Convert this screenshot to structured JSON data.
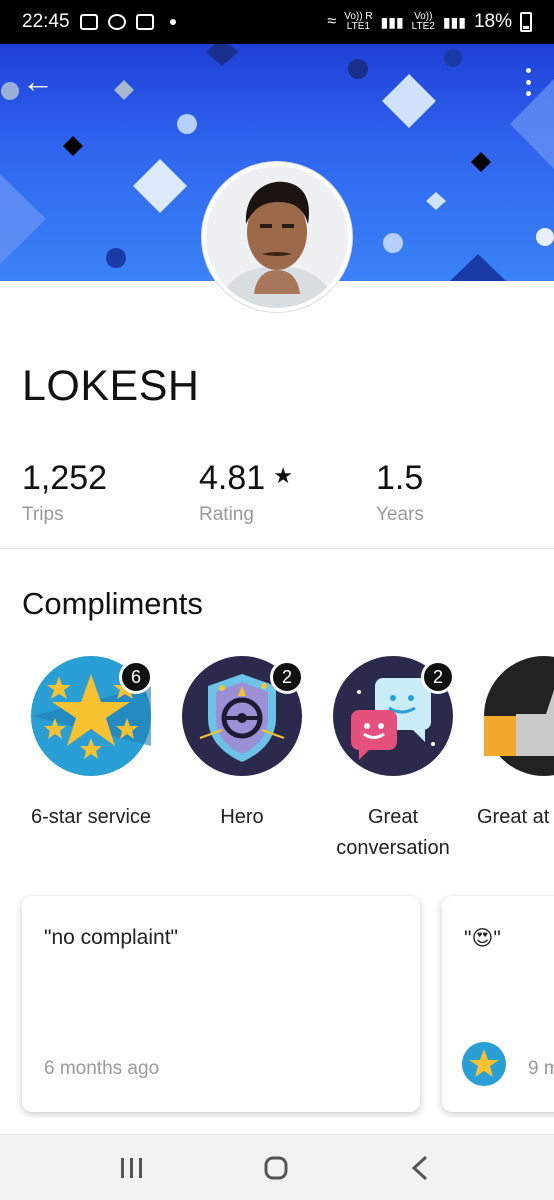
{
  "status_bar": {
    "time": "22:45",
    "network_1": "Vo)) R\nLTE1",
    "network_2": "Vo))\nLTE2",
    "battery_percent": "18%"
  },
  "profile": {
    "name": "LOKESH",
    "avatar": "driver-photo"
  },
  "stats": [
    {
      "value": "1,252",
      "label": "Trips"
    },
    {
      "value": "4.81",
      "label": "Rating",
      "icon": "star-icon"
    },
    {
      "value": "1.5",
      "label": "Years"
    }
  ],
  "compliments": {
    "title": "Compliments",
    "items": [
      {
        "label": "6-star service",
        "count": "6",
        "icon": "six-star-service-icon"
      },
      {
        "label": "Hero",
        "count": "2",
        "icon": "hero-shield-icon"
      },
      {
        "label": "Great conversation",
        "count": "2",
        "icon": "chat-bubbles-icon"
      },
      {
        "label": "Great at",
        "icon": "thumbs-up-icon"
      }
    ]
  },
  "reviews": [
    {
      "quote": "\"no complaint\"",
      "time": "6 months ago"
    },
    {
      "quote": "\"😍\"",
      "time": "9 m"
    }
  ],
  "colors": {
    "banner_top": "#1f3fd7",
    "banner_bottom": "#3b82f6",
    "badge_blue": "#2a9fd6",
    "badge_navy": "#2b2a4c",
    "badge_dark": "#222222"
  }
}
